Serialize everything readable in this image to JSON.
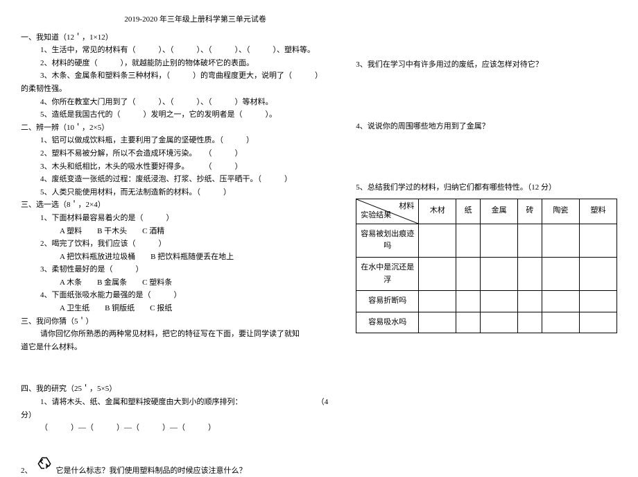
{
  "title": "2019-2020 年三年级上册科学第三单元试卷",
  "s1": {
    "heading": "一、我知道（12＇，1×12）",
    "q1": "1、生活中，常见的材料有（　　　）、（　　　）、（　　　）、（　　　）、塑料等。",
    "q2": "2、材料的硬度（　　　），就越能防止别的物体破坏它的表面。",
    "q3": "3、木条、金属条和塑料条三种材料，（　　　）的弯曲程度更大，说明了（　　　）",
    "q3b": "的柔韧性强。",
    "q4": "4、你所在教室大门用到了（　　　）、（　　　）、（　　　）等材料。",
    "q5": "5、造纸是我国古代的（　　　）发明之一，它的发明者是（　　　）。"
  },
  "s2": {
    "heading": "二、辨一辨（10＇，2×5）",
    "q1": "1、铝可以做成饮料瓶，主要利用了金属的坚硬性质。（　　　）",
    "q2": "2、塑料不易被分解，所以不会造成环境污染。　　（　　　）",
    "q3": "3、木头和纸相比，木头的吸水性要好得多。　　　（　　　）",
    "q4": "4、废纸变造一张纸的过程：废纸浸泡、打浆、抄纸、压平晒干。（　　　）",
    "q5": "5、人类只能使用材料，而无法制造新的材料。（　　　）"
  },
  "s3": {
    "heading": "三、选一选（8＇，2×4）",
    "q1": "1、下面材料最容易着火的是（　　　）",
    "q1opts": "A 塑料　　B 干木头　　C 酒精",
    "q2": "2、喝完了饮料，我们应该（　　　）",
    "q2opts": "A 把饮料瓶放进垃圾桶　　B 把饮料瓶随便丢在地上",
    "q3": "3、柔韧性最好的是（　　　）",
    "q3opts": "A 木条　　B 金属条　　C 塑料条",
    "q4": "4、下面纸张吸水能力最强的是（　　　）",
    "q4opts": "A 卫生纸　　B 铜版纸　　C 报纸"
  },
  "s4": {
    "heading": "三、我问你猜（5＇）",
    "text1": "请你回忆你所熟悉的两种常见材料，把它的特征写在下面，要让同学读了就知",
    "text2": "道它是什么材料。"
  },
  "s5": {
    "heading": "四、我的研究（25＇，5×5）",
    "q1a": "1、请将木头、纸、金属和塑料按硬度由大到小的顺序排列：",
    "q1b": "（4",
    "q1c": "分）",
    "q1blanks": "（　　　）—（　　　）—（　　　）—（　　　）",
    "q2": "它是什么标志？我们使用塑料制品的时候应该注意什么？",
    "q2num": "2、"
  },
  "right": {
    "q3": "3、我们在学习中有许多用过的废纸，应该怎样对待它？",
    "q4": "4、说说你的周围哪些地方用到了金属？",
    "q5": "5、总结我们学过的材料，归纳它们都有哪些特性。（12 分）"
  },
  "table": {
    "diag_top": "材料",
    "diag_bottom": "实验结果",
    "cols": [
      "木材",
      "纸",
      "金属",
      "砖",
      "陶瓷",
      "塑料"
    ],
    "rows": [
      "容易被划出痕迹吗",
      "在水中是沉还是浮",
      "容易折断吗",
      "容易吸水吗"
    ]
  }
}
